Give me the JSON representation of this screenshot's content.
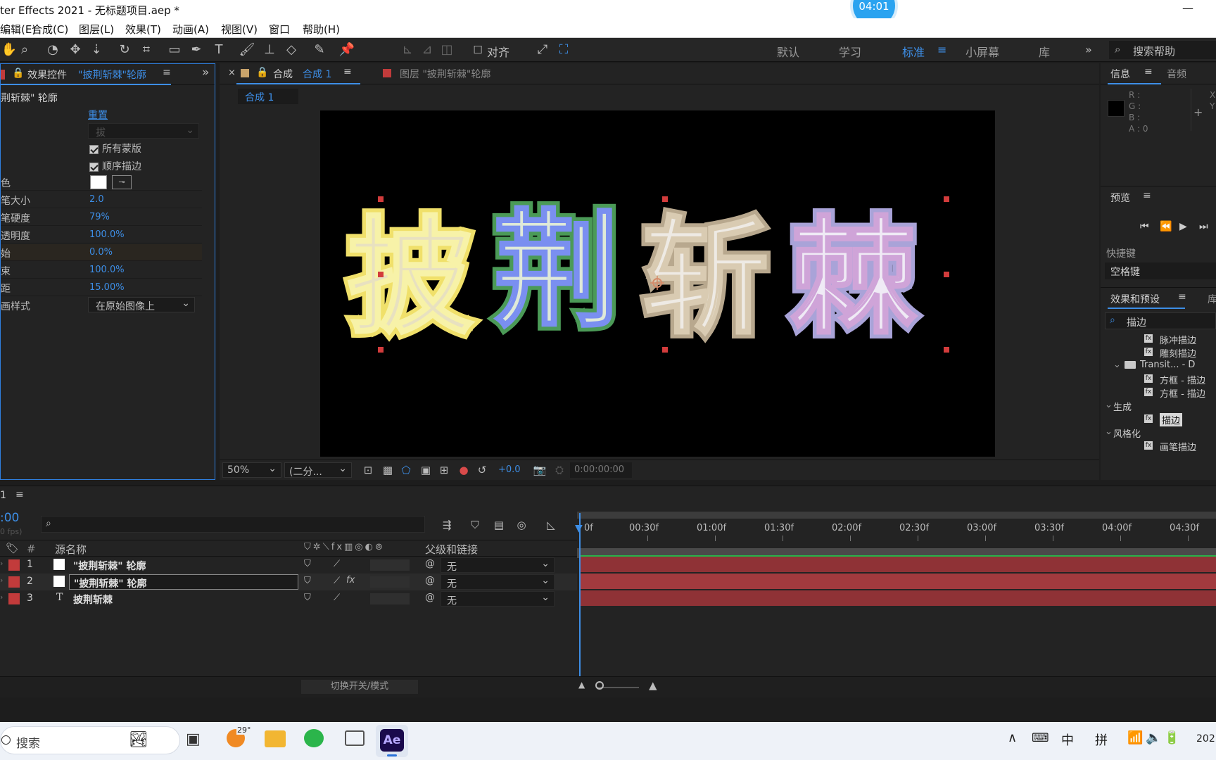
{
  "window": {
    "title": "ter Effects 2021 - 无标题项目.aep *",
    "clock": "04:01",
    "minimize": "—"
  },
  "menu": [
    "编辑(E)",
    "合成(C)",
    "图层(L)",
    "效果(T)",
    "动画(A)",
    "视图(V)",
    "窗口",
    "帮助(H)"
  ],
  "toolbar": {
    "align_label": "对齐",
    "workspaces": [
      "默认",
      "学习",
      "标准",
      "小屏幕",
      "库"
    ],
    "active_workspace": "标准",
    "search_placeholder": "搜索帮助",
    "more": "»"
  },
  "effects_panel": {
    "tab_prefix": "效果控件",
    "tab_target": "\"披荆斩棘\"轮廓",
    "layer_name": "荆斩棘\" 轮廓",
    "reset_label": "重置",
    "path_placeholder": "拔",
    "check_all_masks": "所有蒙版",
    "check_sequential": "顺序描边",
    "properties": [
      {
        "label": "色",
        "value": ""
      },
      {
        "label": "笔大小",
        "value": "2.0"
      },
      {
        "label": "笔硬度",
        "value": "79%"
      },
      {
        "label": "透明度",
        "value": "100.0%"
      },
      {
        "label": "始",
        "value": "0.0%"
      },
      {
        "label": "束",
        "value": "100.0%"
      },
      {
        "label": "距",
        "value": "15.00%"
      },
      {
        "label": "画样式",
        "value": "在原始图像上"
      }
    ]
  },
  "viewer": {
    "comp_tab": "合成",
    "comp_name": "合成 1",
    "layer_tab": "图层 \"披荆斩棘\"轮廓",
    "breadcrumb": "合成 1",
    "text": [
      "披",
      "荆",
      "斩",
      "棘"
    ],
    "zoom": "50%",
    "resolution": "(二分...",
    "exposure": "+0.0",
    "timecode": "0:00:00:00"
  },
  "info_panel": {
    "tab_info": "信息",
    "tab_audio": "音频",
    "r": "R :",
    "g": "G :",
    "b": "B :",
    "a": "A : 0",
    "x": "X",
    "y": "Y",
    "plus": "+"
  },
  "preview_panel": {
    "title": "预览",
    "shortcut_label": "快捷键",
    "shortcut_value": "空格键"
  },
  "fx_presets": {
    "title": "效果和预设",
    "extra": "库",
    "search": "描边",
    "items": [
      {
        "label": "脉冲描边",
        "indent": 2
      },
      {
        "label": "雕刻描边",
        "indent": 2
      },
      {
        "label": "Transit... - D",
        "indent": 1,
        "folder": true
      },
      {
        "label": "方框 - 描边",
        "indent": 2
      },
      {
        "label": "方框 - 描边",
        "indent": 2
      },
      {
        "label": "生成",
        "indent": 0,
        "cat": true
      },
      {
        "label": "描边",
        "indent": 2,
        "selected": true
      },
      {
        "label": "风格化",
        "indent": 0,
        "cat": true
      },
      {
        "label": "画笔描边",
        "indent": 2
      }
    ]
  },
  "timeline": {
    "tab": "1",
    "timecode": ":00",
    "fps": "0 fps)",
    "col_num": "#",
    "col_source": "源名称",
    "col_parent": "父级和链接",
    "toggle_label": "切换开关/模式",
    "ruler": [
      "0f",
      "00:30f",
      "01:00f",
      "01:30f",
      "02:00f",
      "02:30f",
      "03:00f",
      "03:30f",
      "04:00f",
      "04:30f"
    ],
    "layers": [
      {
        "num": "1",
        "name": "\"披荆斩棘\" 轮廓",
        "type": "shape",
        "parent": "无"
      },
      {
        "num": "2",
        "name": "\"披荆斩棘\" 轮廓",
        "type": "shape",
        "parent": "无"
      },
      {
        "num": "3",
        "name": "披荆斩棘",
        "type": "text",
        "parent": "无"
      }
    ]
  },
  "taskbar": {
    "search": "搜索",
    "weather": "29°",
    "ae": "Ae",
    "ime_cn": "中",
    "ime_pin": "拼",
    "year": "202"
  }
}
